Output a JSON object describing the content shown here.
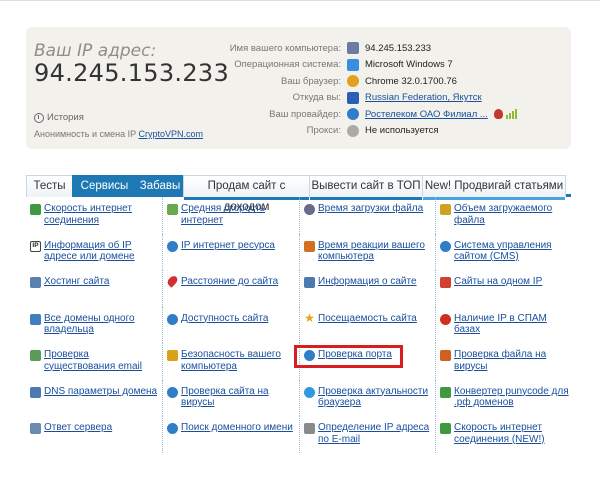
{
  "ip_block": {
    "label": "Ваш IP адрес:",
    "value": "94.245.153.233",
    "history": "История",
    "anon_text": "Анонимность и смена IP",
    "anon_link": "CryptoVPN.com"
  },
  "info": [
    {
      "key": "Имя вашего компьютера:",
      "value": "94.245.153.233",
      "icon": "computer-icon",
      "color": "#6a7ca0",
      "link": false
    },
    {
      "key": "Операционная система:",
      "value": "Microsoft Windows 7",
      "icon": "windows-icon",
      "color": "#3a8ee0",
      "link": false
    },
    {
      "key": "Ваш браузер:",
      "value": "Chrome 32.0.1700.76",
      "icon": "chrome-icon",
      "color": "#e0a020",
      "link": false
    },
    {
      "key": "Откуда вы:",
      "value": "Russian Federation, Якутск",
      "icon": "flag-icon",
      "color": "#2a5fb8",
      "link": true
    },
    {
      "key": "Ваш провайдер:",
      "value": "Ростелеком ОАО Филиал ...",
      "icon": "globe-icon",
      "color": "#2f7fc8",
      "link": true
    },
    {
      "key": "Прокси:",
      "value": "Не используется",
      "icon": "proxy-icon",
      "color": "#aaaaaa",
      "link": false
    }
  ],
  "tabs": [
    {
      "label": "Тесты",
      "active": false,
      "stripe": ""
    },
    {
      "label": "Сервисы",
      "active": true,
      "stripe": ""
    },
    {
      "label": "Забавы",
      "active": true,
      "stripe": ""
    },
    {
      "label": "Продам сайт с доходом",
      "active": false,
      "stripe": "#1e78b4"
    },
    {
      "label": "Вывести сайт в ТОП",
      "active": false,
      "stripe": "#1e78b4"
    },
    {
      "label": "New! Продвигай статьями",
      "active": false,
      "stripe": "#4aa3df"
    }
  ],
  "services": [
    [
      {
        "text": "Скорость интернет соединения",
        "icon": "speed-icon",
        "color": "#3f9a3f"
      },
      {
        "text": "Информация об IP адресе или домене",
        "icon": "ip-icon",
        "color": "#444444"
      },
      {
        "text": "Хостинг сайта",
        "icon": "hosting-icon",
        "color": "#5a7fb0"
      },
      {
        "text": "Все домены одного владельца",
        "icon": "domains-icon",
        "color": "#3f7fc0"
      },
      {
        "text": "Проверка существования email",
        "icon": "email-icon",
        "color": "#5a9a5a"
      },
      {
        "text": "DNS параметры домена",
        "icon": "dns-icon",
        "color": "#4a7ab0"
      },
      {
        "text": "Ответ сервера",
        "icon": "server-icon",
        "color": "#6a8ab0"
      }
    ],
    [
      {
        "text": "Средняя скорость интернет",
        "icon": "avg-speed-icon",
        "color": "#6aa84f"
      },
      {
        "text": "IP интернет ресурса",
        "icon": "resource-ip-icon",
        "color": "#2f7fc8"
      },
      {
        "text": "Расстояние до сайта",
        "icon": "map-pin-icon",
        "color": "#d03030"
      },
      {
        "text": "Доступность сайта",
        "icon": "availability-icon",
        "color": "#2f7fc8"
      },
      {
        "text": "Безопасность вашего компьютера",
        "icon": "lock-icon",
        "color": "#d9a21a"
      },
      {
        "text": "Проверка сайта на вирусы",
        "icon": "virus-check-icon",
        "color": "#2f7fc8"
      },
      {
        "text": "Поиск доменного имени",
        "icon": "domain-search-icon",
        "color": "#2f7fc8"
      }
    ],
    [
      {
        "text": "Время загрузки файла",
        "icon": "clock-icon",
        "color": "#6a6a8a"
      },
      {
        "text": "Время реакции вашего компьютера",
        "icon": "reaction-icon",
        "color": "#d07020"
      },
      {
        "text": "Информация о сайте",
        "icon": "site-info-icon",
        "color": "#4a7ab0"
      },
      {
        "text": "Посещаемость сайта",
        "icon": "star-icon",
        "color": "#e8a020"
      },
      {
        "text": "Проверка порта",
        "icon": "port-icon",
        "color": "#2f7fc8"
      },
      {
        "text": "Проверка актуальности браузера",
        "icon": "browser-icon",
        "color": "#2f9ae0"
      },
      {
        "text": "Определение IP адреса по E-mail",
        "icon": "email-ip-icon",
        "color": "#8a8a8a"
      }
    ],
    [
      {
        "text": "Объем загружаемого файла",
        "icon": "file-size-icon",
        "color": "#d0a020"
      },
      {
        "text": "Система управления сайтом (CMS)",
        "icon": "cms-icon",
        "color": "#2f7fc8"
      },
      {
        "text": "Сайты на одном IP",
        "icon": "same-ip-icon",
        "color": "#d04030"
      },
      {
        "text": "Наличие IP в СПАМ базах",
        "icon": "spam-icon",
        "color": "#d03020"
      },
      {
        "text": "Проверка файла на вирусы",
        "icon": "file-virus-icon",
        "color": "#d06020"
      },
      {
        "text": "Конвертер punycode для .рф доменов",
        "icon": "punycode-icon",
        "color": "#3f9a3f"
      },
      {
        "text": "Скорость интернет соединения (NEW!)",
        "icon": "speed-new-icon",
        "color": "#3f9a3f"
      }
    ]
  ],
  "highlight": {
    "column": 2,
    "row": 4
  }
}
